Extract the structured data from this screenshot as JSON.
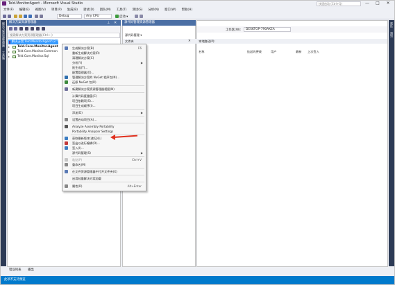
{
  "window": {
    "title": "Teld.MonitorAgent - Microsoft Visual Studio",
    "quick_launch_placeholder": "快速启动 (Ctrl+Q)",
    "controls": [
      "—",
      "□",
      "✕"
    ]
  },
  "menubar": [
    "文件(F)",
    "编辑(E)",
    "视图(V)",
    "项目(P)",
    "生成(B)",
    "调试(D)",
    "团队(M)",
    "工具(T)",
    "测试(S)",
    "分析(N)",
    "窗口(W)",
    "帮助(H)"
  ],
  "toolbar": {
    "config": "Debug",
    "platform": "Any CPU",
    "start": "启动 ▾"
  },
  "left_strip": [
    "解决方案资源管理器",
    "工具箱"
  ],
  "right_strip": [
    "属性",
    "通知"
  ],
  "solution_explorer": {
    "title": "解决方案资源管理器",
    "search_placeholder": "搜索解决方案资源管理器(Ctrl+;)",
    "items": [
      {
        "label": "解决方案'Teld.MonitorAgent'(3 个项目)",
        "selected": true
      },
      {
        "label": "Teld.Core.Monitor.Agent"
      },
      {
        "label": "Teld.Core.Monitor.Common"
      },
      {
        "label": "Teld.Core.Monitor.Sql"
      }
    ]
  },
  "doc_panel": {
    "tab": "源代码管理资源管理器",
    "sub": "文件夹"
  },
  "pending_panel": {
    "sub": "源代码管理 ▾",
    "work_label": "工作区(W):",
    "work_value": "DESKTOP-790AKEA",
    "sub2": "本地路径(P):",
    "columns": [
      "名称",
      "挂起的更改",
      "用户",
      "最新",
      "上次签入"
    ]
  },
  "context_menu": {
    "items": [
      {
        "label": "生成解决方案(B)",
        "shortcut": "F6"
      },
      {
        "label": "重新生成解决方案(R)"
      },
      {
        "label": "清理解决方案(C)"
      },
      {
        "label": "分析(Y)",
        "sub": true
      },
      {
        "label": "批生成(T)..."
      },
      {
        "label": "配置管理器(O)..."
      },
      {
        "label": "管理解决方案的 NuGet 程序包(N)..."
      },
      {
        "label": "还原 NuGet 包(R)"
      },
      {
        "label": "新建解决方案资源管理器视图(N)"
      },
      {
        "label": "计算代码度量值(C)"
      },
      {
        "label": "项目依赖项(S)..."
      },
      {
        "label": "项目生成顺序(I)..."
      },
      {
        "label": "添加(D)",
        "sub": true
      },
      {
        "label": "设置启动项目(A)..."
      },
      {
        "label": "Analyze Assembly Portability"
      },
      {
        "label": "Portability Analyzer Settings"
      },
      {
        "label": "获取最新版本(递归)(L)"
      },
      {
        "label": "签出以进行编辑(O)..."
      },
      {
        "label": "签入(I)..."
      },
      {
        "label": "源代码管理(S)",
        "sub": true
      },
      {
        "label": "粘贴(P)",
        "shortcut": "Ctrl+V",
        "disabled": true
      },
      {
        "label": "重命名(M)"
      },
      {
        "label": "在文件资源管理器中打开文件夹(X)"
      },
      {
        "label": "启用轻量解决方案加载"
      },
      {
        "label": "属性(R)",
        "shortcut": "Alt+Enter"
      }
    ]
  },
  "bottom_tabs": [
    "错误列表",
    "输出"
  ],
  "status": "此项不支持预览",
  "colors": {
    "accent": "#007acc",
    "title_blue": "#4b6fa5",
    "annotation_arrow": "#e0301e"
  }
}
